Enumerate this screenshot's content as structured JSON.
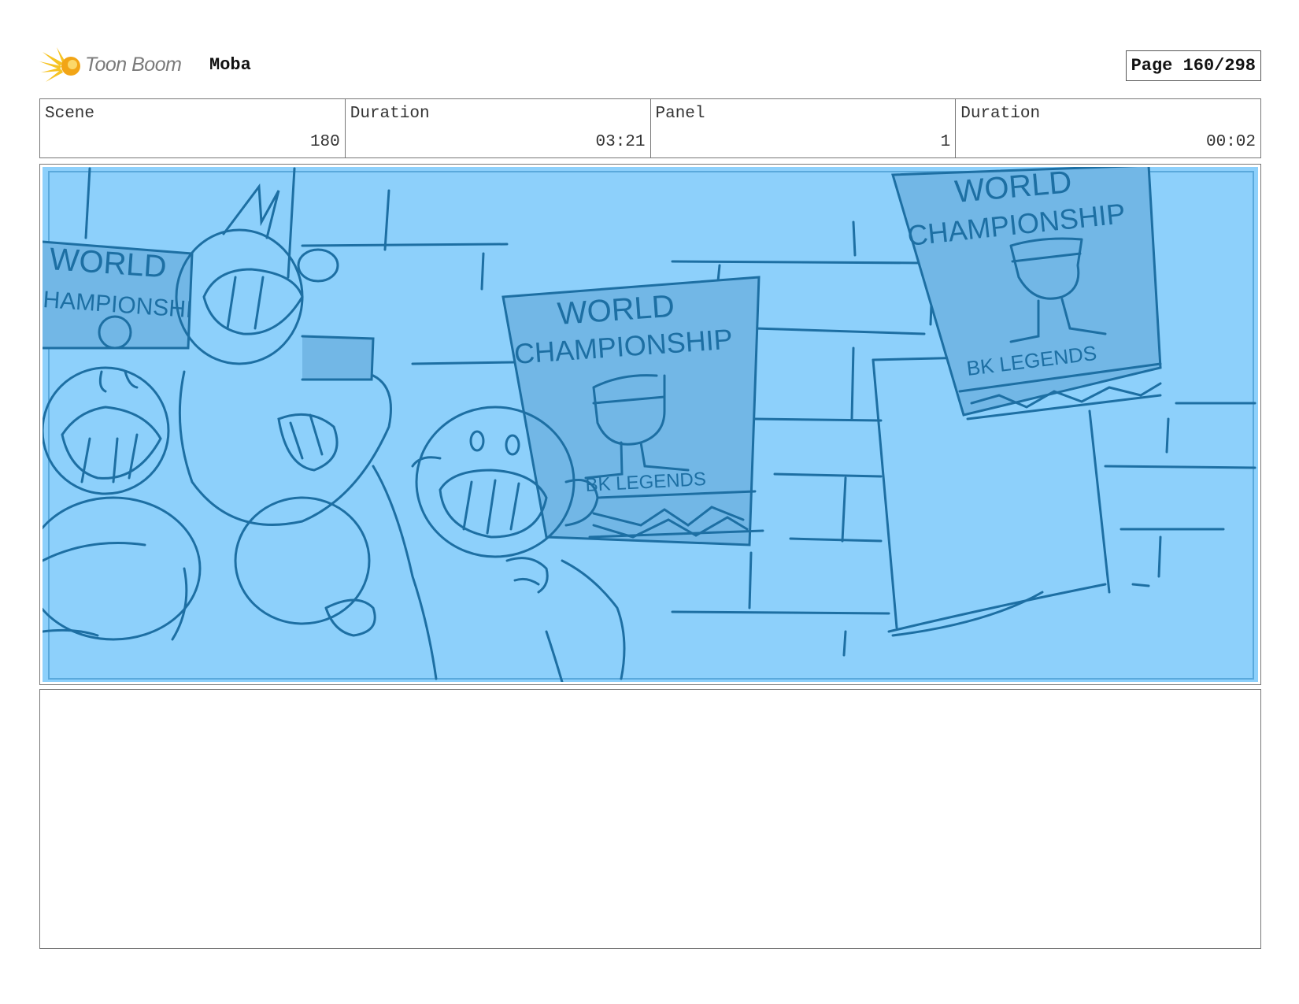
{
  "header": {
    "brand": "Toon Boom",
    "project": "Moba",
    "page": "Page 160/298"
  },
  "info": {
    "scene_label": "Scene",
    "scene_value": "180",
    "duration_label": "Duration",
    "duration_value": "03:21",
    "panel_label": "Panel",
    "panel_value": "1",
    "panel_duration_label": "Duration",
    "panel_duration_value": "00:02"
  },
  "panel": {
    "poster_left_line1": "WORLD",
    "poster_left_line2": "HAMPIONSHI",
    "poster_center_line1": "WORLD",
    "poster_center_line2": "CHAMPIONSHIP",
    "poster_center_line3": "BK LEGENDS",
    "poster_right_line1": "WORLD",
    "poster_right_line2": "CHAMPIONSHIP",
    "poster_right_line3": "BK LEGENDS",
    "colors": {
      "background": "#8dd0fb",
      "line": "#1d6fa3",
      "poster": "#72b7e6"
    }
  },
  "notes": ""
}
